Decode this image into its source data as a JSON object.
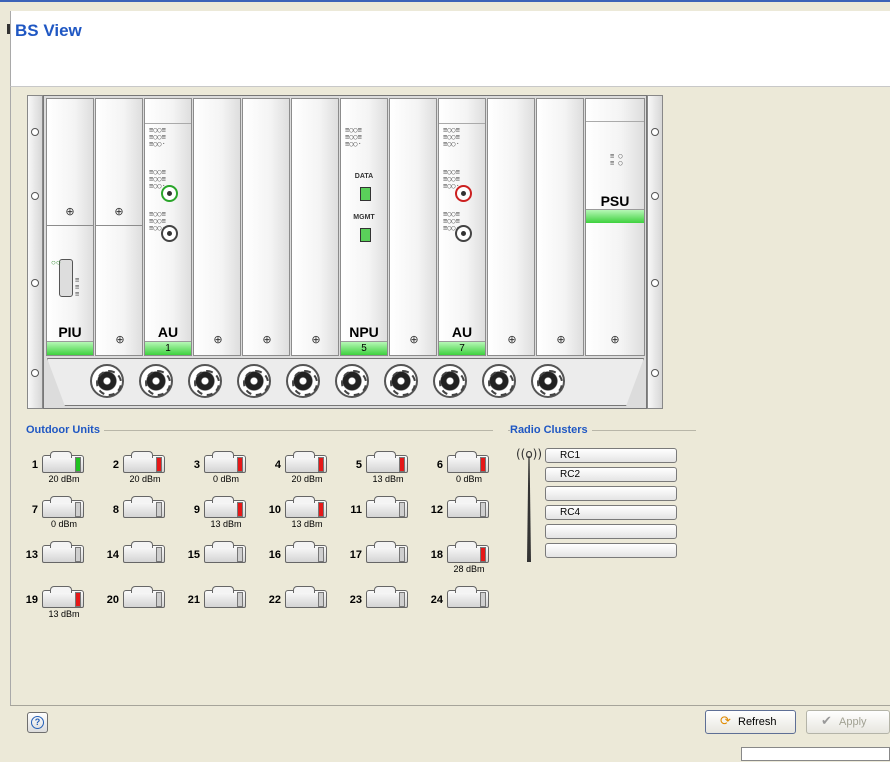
{
  "header": {
    "title": "BS View"
  },
  "chassis": {
    "slots": [
      {
        "name": "PIU",
        "number": ""
      },
      {
        "name": "",
        "number": ""
      },
      {
        "name": "AU",
        "number": "1"
      },
      {
        "name": "",
        "number": ""
      },
      {
        "name": "",
        "number": ""
      },
      {
        "name": "",
        "number": ""
      },
      {
        "name": "NPU",
        "number": "5",
        "port_labels": [
          "DATA",
          "MGMT"
        ]
      },
      {
        "name": "",
        "number": ""
      },
      {
        "name": "AU",
        "number": "7"
      },
      {
        "name": "",
        "number": ""
      },
      {
        "name": "",
        "number": ""
      },
      {
        "name": "PSU",
        "number": ""
      }
    ],
    "fan_count": 10
  },
  "outdoor_units": {
    "title": "Outdoor Units",
    "units": [
      {
        "num": "1",
        "power": "20 dBm",
        "status": "green"
      },
      {
        "num": "2",
        "power": "20 dBm",
        "status": "red"
      },
      {
        "num": "3",
        "power": "0 dBm",
        "status": "red"
      },
      {
        "num": "4",
        "power": "20 dBm",
        "status": "red"
      },
      {
        "num": "5",
        "power": "13 dBm",
        "status": "red"
      },
      {
        "num": "6",
        "power": "0 dBm",
        "status": "red"
      },
      {
        "num": "7",
        "power": "0 dBm",
        "status": "none"
      },
      {
        "num": "8",
        "power": "",
        "status": "none"
      },
      {
        "num": "9",
        "power": "13 dBm",
        "status": "red"
      },
      {
        "num": "10",
        "power": "13 dBm",
        "status": "red"
      },
      {
        "num": "11",
        "power": "",
        "status": "none"
      },
      {
        "num": "12",
        "power": "",
        "status": "none"
      },
      {
        "num": "13",
        "power": "",
        "status": "none"
      },
      {
        "num": "14",
        "power": "",
        "status": "none"
      },
      {
        "num": "15",
        "power": "",
        "status": "none"
      },
      {
        "num": "16",
        "power": "",
        "status": "none"
      },
      {
        "num": "17",
        "power": "",
        "status": "none"
      },
      {
        "num": "18",
        "power": "28 dBm",
        "status": "red"
      },
      {
        "num": "19",
        "power": "13 dBm",
        "status": "red"
      },
      {
        "num": "20",
        "power": "",
        "status": "none"
      },
      {
        "num": "21",
        "power": "",
        "status": "none"
      },
      {
        "num": "22",
        "power": "",
        "status": "none"
      },
      {
        "num": "23",
        "power": "",
        "status": "none"
      },
      {
        "num": "24",
        "power": "",
        "status": "none"
      }
    ]
  },
  "radio_clusters": {
    "title": "Radio Clusters",
    "items": [
      "RC1",
      "RC2",
      "",
      "RC4",
      "",
      ""
    ]
  },
  "footer": {
    "help_icon": "help-icon",
    "refresh_label": "Refresh",
    "apply_label": "Apply"
  },
  "colors": {
    "title_blue": "#1f57c3",
    "status_green": "#1fc21f",
    "status_red": "#e51818",
    "slot_bar_green": "#3ed13e"
  }
}
